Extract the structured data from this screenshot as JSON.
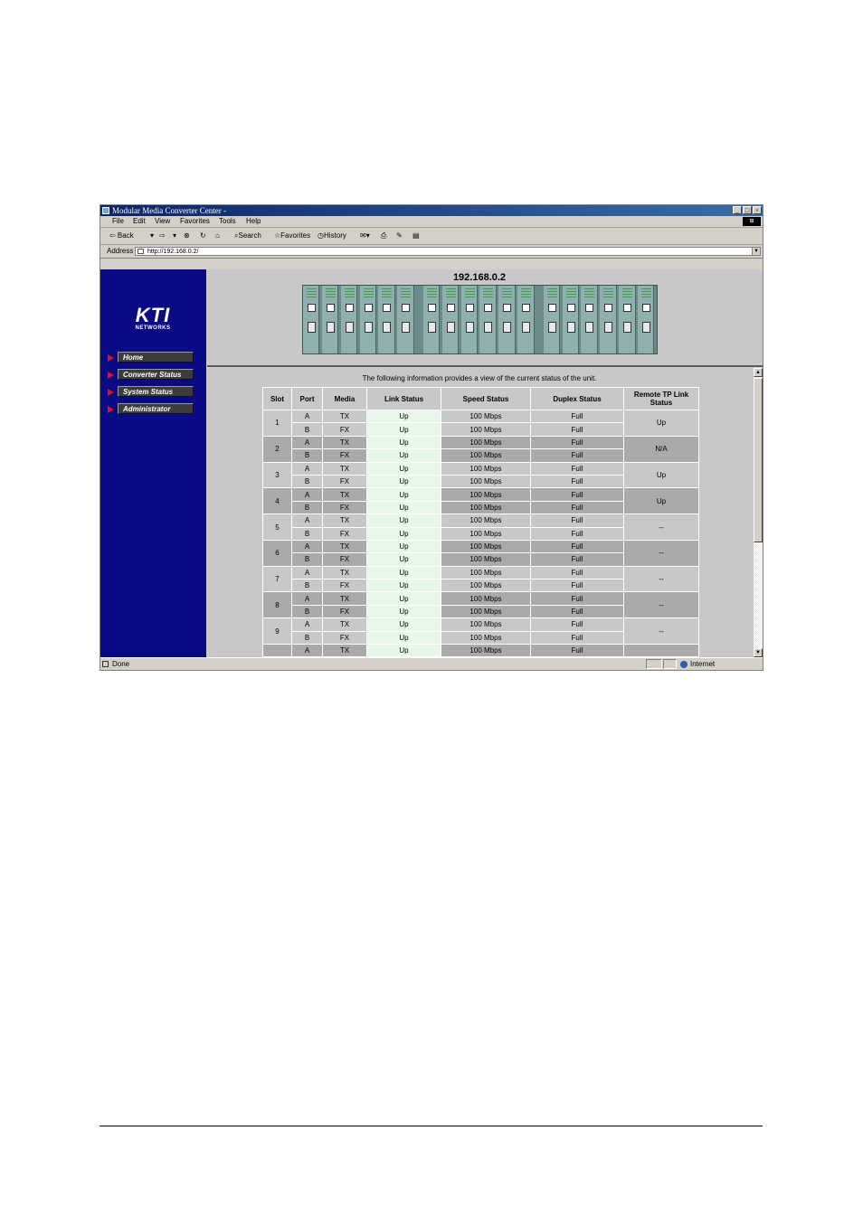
{
  "window": {
    "title": "Modular Media Converter Center -",
    "buttons": [
      "_",
      "□",
      "×"
    ]
  },
  "menu": [
    "File",
    "Edit",
    "View",
    "Favorites",
    "Tools",
    "Help"
  ],
  "toolbar": {
    "back": "⇦ Back",
    "back_drop": "▾",
    "forward": "⇨",
    "forward_drop": "▾",
    "stop": "⊗",
    "refresh": "↻",
    "home": "⌂",
    "search": "Search",
    "favorites": "Favorites",
    "history": "History",
    "mail": "✉▾",
    "print": "⎙",
    "edit": "✎",
    "discuss": "▤"
  },
  "address": {
    "label": "Address",
    "url": "http://192.168.0.2/"
  },
  "logo": {
    "text": "KTI",
    "sub": "NETWORKS"
  },
  "nav": [
    "Home",
    "Converter Status",
    "System Status",
    "Administrator"
  ],
  "device": {
    "ip": "192.168.0.2"
  },
  "intro": "The following information provides a view of the current status of the unit.",
  "table": {
    "headers": [
      "Slot",
      "Port",
      "Media",
      "Link Status",
      "Speed Status",
      "Duplex Status",
      "Remote TP Link Status"
    ],
    "slots": [
      {
        "slot": "1",
        "remote": "Up",
        "ports": [
          [
            "A",
            "TX",
            "Up",
            "100 Mbps",
            "Full"
          ],
          [
            "B",
            "FX",
            "Up",
            "100 Mbps",
            "Full"
          ]
        ]
      },
      {
        "slot": "2",
        "remote": "N/A",
        "ports": [
          [
            "A",
            "TX",
            "Up",
            "100 Mbps",
            "Full"
          ],
          [
            "B",
            "FX",
            "Up",
            "100 Mbps",
            "Full"
          ]
        ]
      },
      {
        "slot": "3",
        "remote": "Up",
        "ports": [
          [
            "A",
            "TX",
            "Up",
            "100 Mbps",
            "Full"
          ],
          [
            "B",
            "FX",
            "Up",
            "100 Mbps",
            "Full"
          ]
        ]
      },
      {
        "slot": "4",
        "remote": "Up",
        "ports": [
          [
            "A",
            "TX",
            "Up",
            "100 Mbps",
            "Full"
          ],
          [
            "B",
            "FX",
            "Up",
            "100 Mbps",
            "Full"
          ]
        ]
      },
      {
        "slot": "5",
        "remote": "--",
        "ports": [
          [
            "A",
            "TX",
            "Up",
            "100 Mbps",
            "Full"
          ],
          [
            "B",
            "FX",
            "Up",
            "100 Mbps",
            "Full"
          ]
        ]
      },
      {
        "slot": "6",
        "remote": "--",
        "ports": [
          [
            "A",
            "TX",
            "Up",
            "100 Mbps",
            "Full"
          ],
          [
            "B",
            "FX",
            "Up",
            "100 Mbps",
            "Full"
          ]
        ]
      },
      {
        "slot": "7",
        "remote": "--",
        "ports": [
          [
            "A",
            "TX",
            "Up",
            "100 Mbps",
            "Full"
          ],
          [
            "B",
            "FX",
            "Up",
            "100 Mbps",
            "Full"
          ]
        ]
      },
      {
        "slot": "8",
        "remote": "--",
        "ports": [
          [
            "A",
            "TX",
            "Up",
            "100 Mbps",
            "Full"
          ],
          [
            "B",
            "FX",
            "Up",
            "100 Mbps",
            "Full"
          ]
        ]
      },
      {
        "slot": "9",
        "remote": "--",
        "ports": [
          [
            "A",
            "TX",
            "Up",
            "100 Mbps",
            "Full"
          ],
          [
            "B",
            "FX",
            "Up",
            "100 Mbps",
            "Full"
          ]
        ]
      },
      {
        "slot": "",
        "remote": "",
        "ports": [
          [
            "A",
            "TX",
            "Up",
            "100 Mbps",
            "Full"
          ]
        ]
      }
    ]
  },
  "status": {
    "text": "Done",
    "zone": "Internet"
  }
}
